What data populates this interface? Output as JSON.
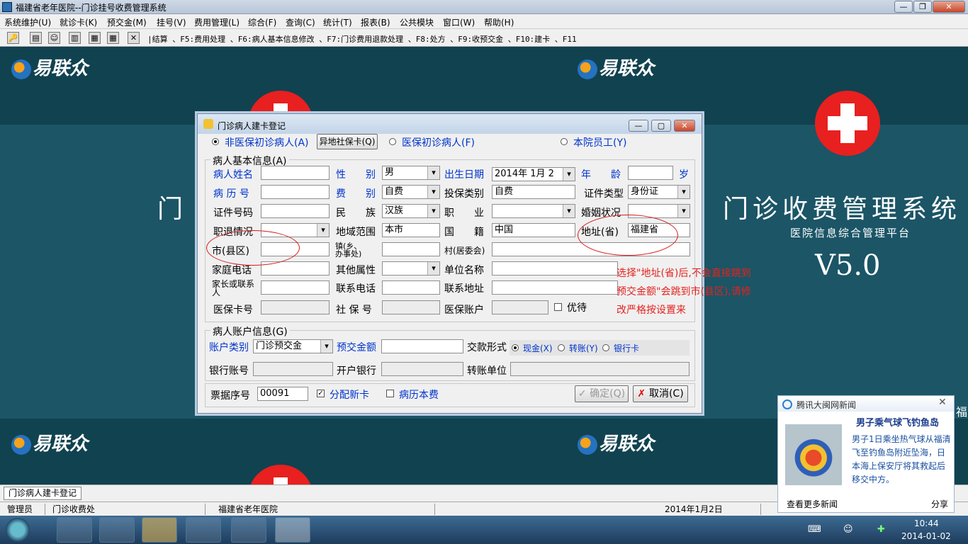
{
  "window": {
    "title": "福建省老年医院--门诊挂号收费管理系统"
  },
  "menu": [
    "系统维护(U)",
    "就诊卡(K)",
    "预交金(M)",
    "挂号(V)",
    "费用管理(L)",
    "综合(F)",
    "查询(C)",
    "统计(T)",
    "报表(B)",
    "公共模块",
    "窗口(W)",
    "帮助(H)"
  ],
  "toolbar": {
    "hotkeys": "|结算 、F5:费用处理 、F6:病人基本信息修改 、F7:门诊费用退款处理 、F8:处方 、F9:收预交金 、F10:建卡 、F11"
  },
  "background": {
    "logo": "易联众",
    "title_left": "门 诊",
    "title_right": "门诊收费管理系统",
    "subtitle": "医院信息综合管理平台",
    "version": "V5.0",
    "cut_char": "福"
  },
  "dialog": {
    "title": "门诊病人建卡登记",
    "patient_type": {
      "non_insured": "非医保初诊病人(A)",
      "remote_card_btn": "异地社保卡(Q)",
      "insured": "医保初诊病人(F)",
      "staff": "本院员工(Y)"
    },
    "basic_info": {
      "legend": "病人基本信息(A)",
      "name_label": "病人姓名",
      "gender_label": "性　　别",
      "gender": "男",
      "dob_label": "出生日期",
      "dob": "2014年 1月 2",
      "age_label": "年　　龄",
      "age_unit": "岁",
      "record_no_label": "病 历 号",
      "fee_type_label": "费　　别",
      "fee_type": "自费",
      "insure_cat_label": "投保类别",
      "insure_cat": "自费",
      "id_type_label": "证件类型",
      "id_type": "身份证",
      "id_no_label": "证件号码",
      "ethnic_label": "民　　族",
      "ethnic": "汉族",
      "job_label": "职　　业",
      "marital_label": "婚姻状况",
      "retire_label": "职退情况",
      "region_label": "地域范围",
      "region": "本市",
      "nationality_label": "国　　籍",
      "nationality": "中国",
      "province_label": "地址(省)",
      "province": "福建省",
      "city_label": "市(县区)",
      "town_label_1": "镇(乡、",
      "town_label_2": "办事处)",
      "village_label": "村(居委会)",
      "home_phone_label": "家庭电话",
      "other_attr_label": "其他属性",
      "employer_label": "单位名称",
      "guardian_label_1": "家长或联系",
      "guardian_label_2": "人",
      "contact_phone_label": "联系电话",
      "contact_addr_label": "联系地址",
      "insurance_no_label": "医保卡号",
      "social_no_label": "社 保 号",
      "insurance_acct_label": "医保账户",
      "priority_label": "优待"
    },
    "note": [
      "选择\"地址(省)后,不会直接跳到",
      "预交金额\"会跳到市(县区),请修",
      "改严格按设置来"
    ],
    "account": {
      "legend": "病人账户信息(G)",
      "acct_type_label": "账户类别",
      "acct_type": "门诊预交金",
      "prepay_label": "预交金额",
      "pay_form_label": "交款形式",
      "cash": "现金(X)",
      "transfer": "转账(Y)",
      "bank_card": "银行卡",
      "bank_acct_label": "银行账号",
      "bank_label": "开户银行",
      "transfer_unit_label": "转账单位"
    },
    "footer": {
      "receipt_label": "票据序号",
      "receipt_no": "00091",
      "new_card": "分配新卡",
      "record_fee": "病历本费",
      "ok": "确定(Q)",
      "cancel": "取消(C)"
    }
  },
  "tabs": [
    "门诊病人建卡登记"
  ],
  "status": {
    "user": "管理员",
    "dept": "门诊收费处",
    "hospital": "福建省老年医院",
    "datetime": "2014年1月2日 10:44:43"
  },
  "news": {
    "header": "腾讯大闽网新闻",
    "headline": "男子乘气球飞钓鱼岛",
    "body": "男子1日乘坐热气球从福清飞至钓鱼岛附近坠海，日本海上保安厅将其救起后移交中方。",
    "more": "查看更多新闻",
    "share": "分享"
  },
  "clock": {
    "time": "10:44",
    "date": "2014-01-02"
  }
}
